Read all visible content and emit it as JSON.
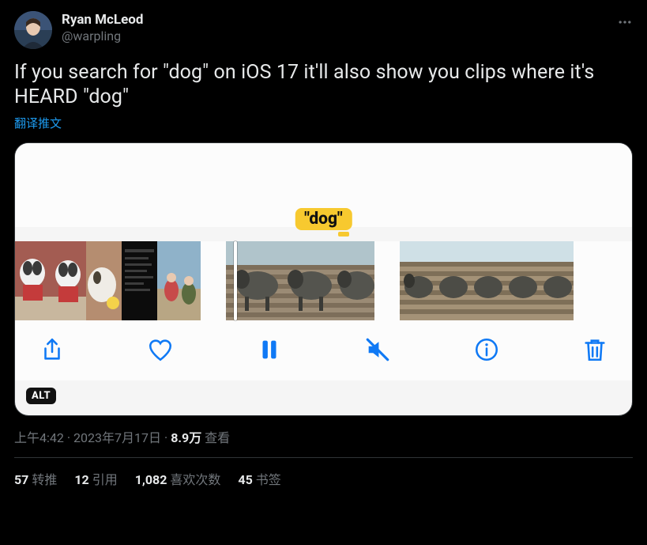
{
  "author": {
    "display_name": "Ryan McLeod",
    "handle": "@warpling"
  },
  "text": "If you search for \"dog\" on iOS 17 it'll also show you clips where it's HEARD \"dog\"",
  "translate_label": "翻译推文",
  "media": {
    "search_pill": "\"dog\"",
    "alt_badge": "ALT",
    "toolbar": {
      "share": "share-icon",
      "like": "heart-icon",
      "pause": "pause-icon",
      "mute": "mute-icon",
      "info": "info-icon",
      "trash": "trash-icon"
    }
  },
  "meta": {
    "time": "上午4:42",
    "date": "2023年7月17日",
    "views_count": "8.9万",
    "views_label": "查看"
  },
  "stats": {
    "reposts_count": "57",
    "reposts_label": "转推",
    "quotes_count": "12",
    "quotes_label": "引用",
    "likes_count": "1,082",
    "likes_label": "喜欢次数",
    "bookmarks_count": "45",
    "bookmarks_label": "书签"
  }
}
